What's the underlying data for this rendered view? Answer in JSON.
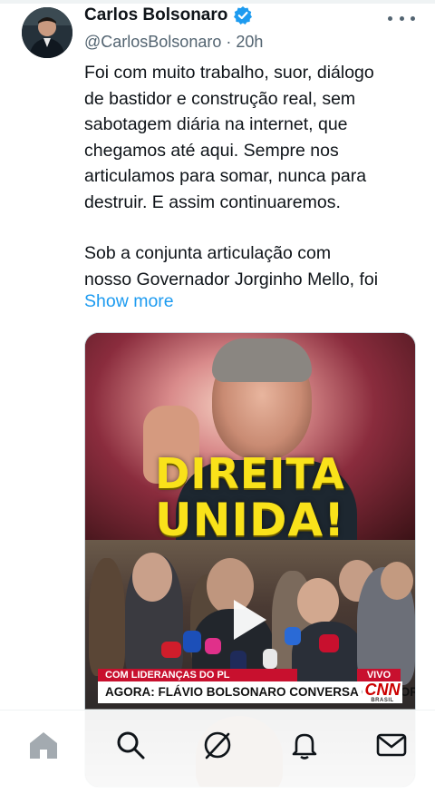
{
  "post": {
    "author_name": "Carlos Bolsonaro",
    "verified": true,
    "handle": "@CarlosBolsonaro",
    "separator": "·",
    "time_ago": "20h",
    "paragraph1": "Foi com muito trabalho, suor, diálogo\nde bastidor e construção real, sem\nsabotagem diária na internet, que\nchegamos até aqui. Sempre nos\narticulamos para somar, nunca para\ndestruir. E assim continuaremos.",
    "paragraph2": "Sob a conjunta articulação com\nnosso Governador Jorginho Mello, foi",
    "show_more_label": "Show more"
  },
  "media": {
    "headline_line1": "DIREITA",
    "headline_line2": "UNIDA!",
    "chyron_top": "COM LIDERANÇAS DO PL",
    "chyron_live": "VIVO",
    "chyron_main": "AGORA: FLÁVIO BOLSONARO CONVERSA COM JORNALISTAS",
    "network_logo": "CNN",
    "network_sub": "BRASIL"
  },
  "nav": {
    "items": [
      "home-icon",
      "search-icon",
      "grok-icon",
      "notifications-icon",
      "messages-icon"
    ]
  },
  "colors": {
    "accent": "#1d9bf0",
    "text": "#0f1419",
    "secondary": "#536471",
    "headline": "#f9e21a",
    "chyron_red": "#c8102e"
  }
}
